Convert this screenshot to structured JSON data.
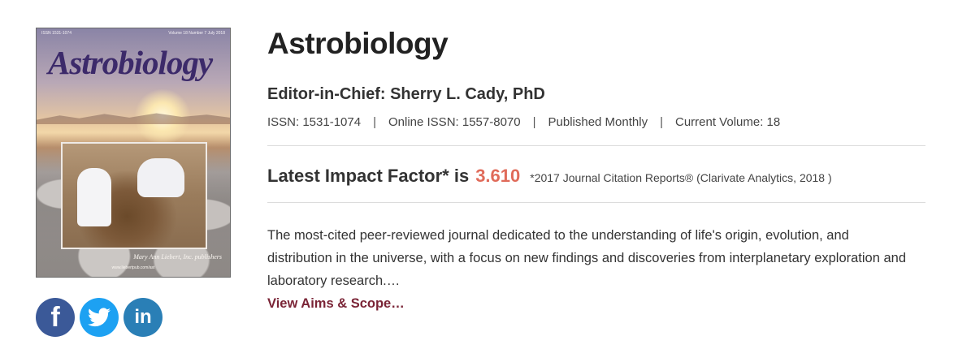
{
  "cover": {
    "issn_line": "ISSN 1531-1074",
    "issue_line": "Volume 18 Number 7 July 2018",
    "title": "Astrobiology",
    "publisher": "Mary Ann Liebert, Inc. publishers",
    "url": "www.liebertpub.com/ast"
  },
  "social": {
    "facebook": "f",
    "linkedin": "in"
  },
  "journal": {
    "title": "Astrobiology",
    "editor": "Editor-in-Chief: Sherry L. Cady, PhD",
    "issn": "ISSN: 1531-1074",
    "online_issn": "Online ISSN: 1557-8070",
    "frequency": "Published Monthly",
    "volume": "Current Volume: 18",
    "separator": "|"
  },
  "impact": {
    "label": "Latest Impact Factor* is",
    "value": "3.610",
    "note": "*2017 Journal Citation Reports® (Clarivate Analytics, 2018 )"
  },
  "description": {
    "text": "The most-cited peer-reviewed journal dedicated to the understanding of life's origin, evolution, and distribution in the universe, with a focus on new findings and discoveries from interplanetary exploration and laboratory research.…",
    "more_link": "View Aims & Scope…"
  },
  "colors": {
    "impact_value": "#e06b5a",
    "link": "#7a2436",
    "facebook": "#3b5998",
    "twitter": "#1da1f2",
    "linkedin": "#2a7fb6"
  }
}
